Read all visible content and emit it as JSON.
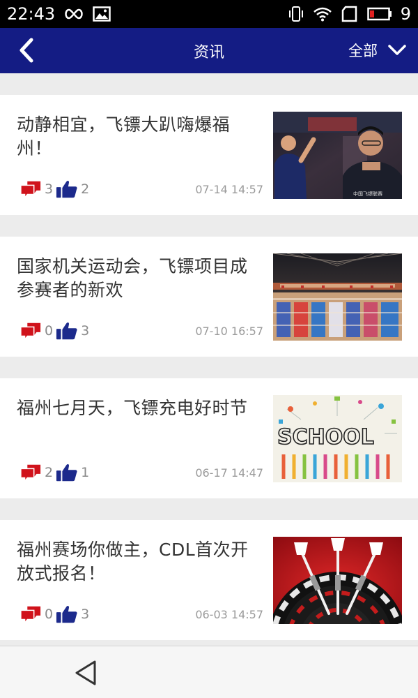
{
  "status_bar": {
    "time": "22:43",
    "battery_level": "9",
    "icons": [
      "infinity-icon",
      "image-icon",
      "vibrate-icon",
      "wifi-icon",
      "sim-icon",
      "battery-icon"
    ]
  },
  "header": {
    "title": "资讯",
    "filter_label": "全部",
    "background": "#141c84"
  },
  "news": [
    {
      "title": "动静相宜，飞镖大趴嗨爆福州！",
      "dislikes": "3",
      "likes": "2",
      "time": "07-14 14:57",
      "thumb_caption": "中国飞镖联赛"
    },
    {
      "title": "国家机关运动会，飞镖项目成参赛者的新欢",
      "dislikes": "0",
      "likes": "3",
      "time": "07-10 16:57"
    },
    {
      "title": "福州七月天，飞镖充电好时节",
      "dislikes": "2",
      "likes": "1",
      "time": "06-17 14:47",
      "thumb_text": "SCHOOL"
    },
    {
      "title": "福州赛场你做主，CDL首次开放式报名！",
      "dislikes": "0",
      "likes": "3",
      "time": "06-03 14:57"
    }
  ],
  "colors": {
    "dislike_icon": "#d0121b",
    "like_icon": "#1c2a8c"
  }
}
